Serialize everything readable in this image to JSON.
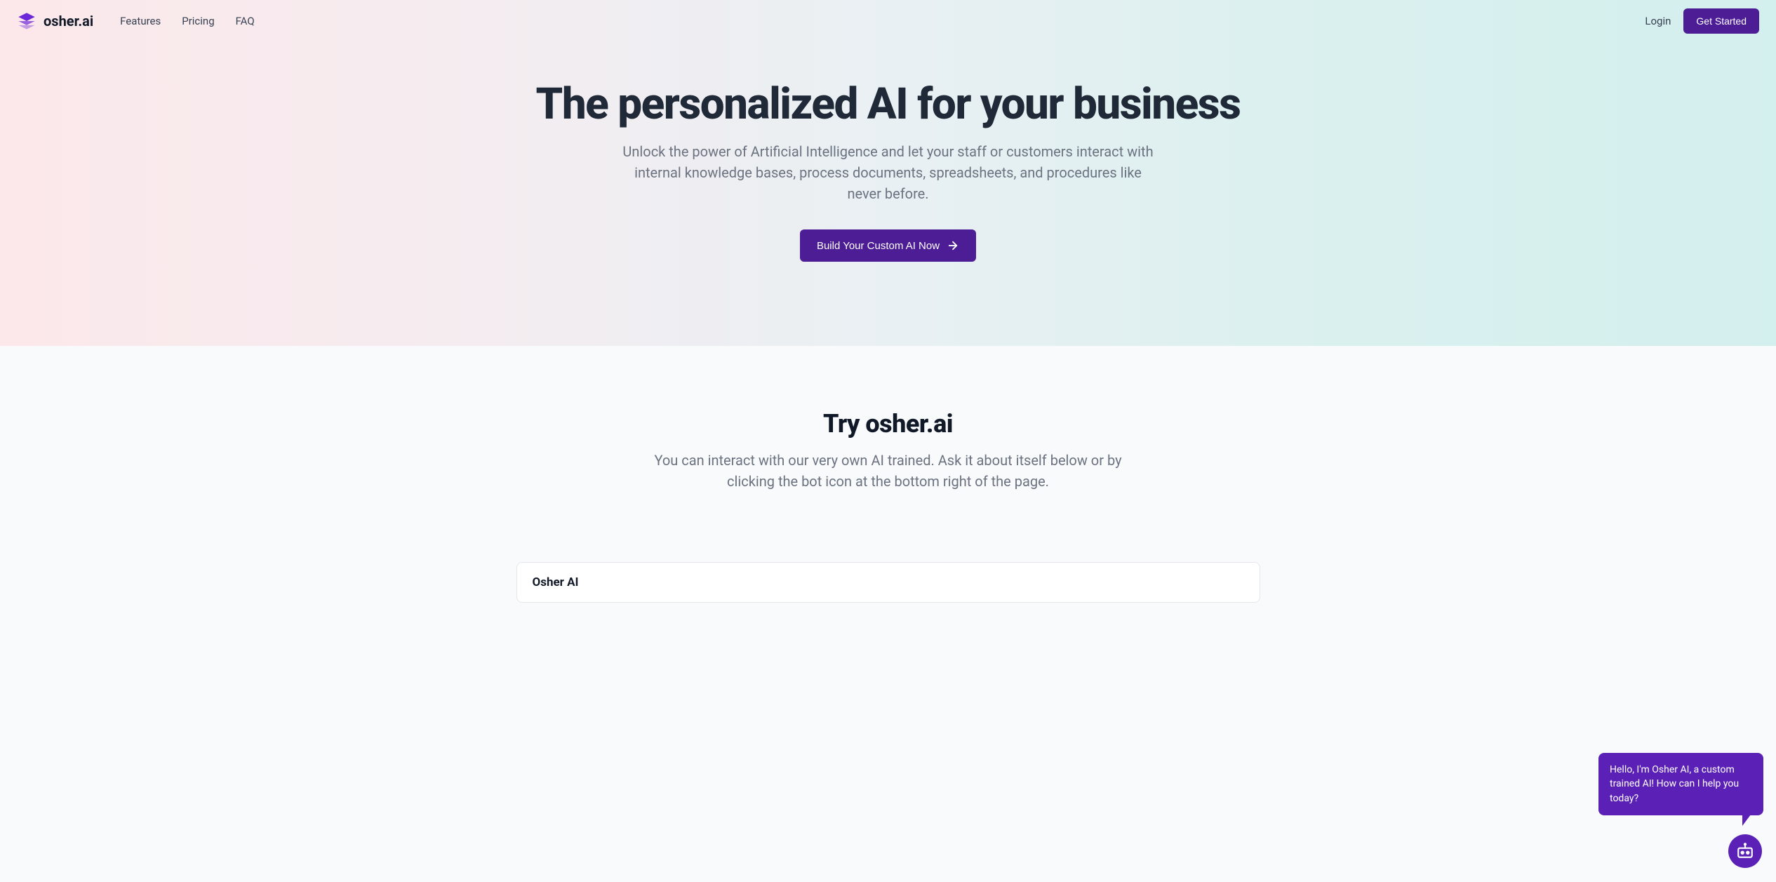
{
  "brand": {
    "name": "osher.ai"
  },
  "nav": {
    "links": [
      "Features",
      "Pricing",
      "FAQ"
    ],
    "login": "Login",
    "get_started": "Get Started"
  },
  "hero": {
    "title": "The personalized AI for your business",
    "subtitle": "Unlock the power of Artificial Intelligence and let your staff or customers interact with internal knowledge bases, process documents, spreadsheets, and procedures like never before.",
    "cta": "Build Your Custom AI Now"
  },
  "try": {
    "title": "Try osher.ai",
    "subtitle": "You can interact with our very own AI trained. Ask it about itself below or by clicking the bot icon at the bottom right of the page.",
    "card_title": "Osher AI"
  },
  "chat": {
    "bubble": "Hello, I'm Osher AI, a custom trained AI! How can I help you today?"
  }
}
